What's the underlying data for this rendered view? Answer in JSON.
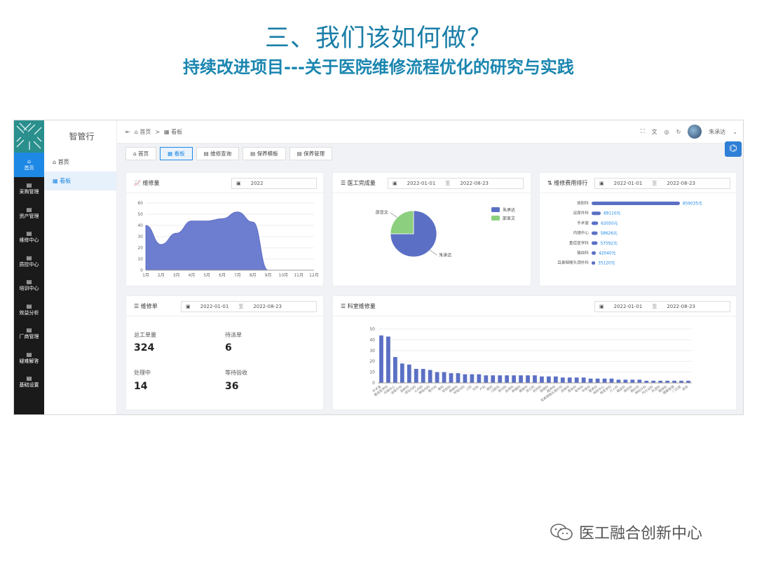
{
  "slide": {
    "title": "三、我们该如何做？",
    "subtitle": "持续改进项目---关于医院维修流程优化的研究与实践"
  },
  "nav": {
    "items": [
      {
        "label": "首页",
        "icon": "home-icon"
      },
      {
        "label": "采购管理",
        "icon": "doc-icon"
      },
      {
        "label": "资产管理",
        "icon": "doc-icon"
      },
      {
        "label": "维修中心",
        "icon": "doc-icon"
      },
      {
        "label": "质控中心",
        "icon": "doc-icon"
      },
      {
        "label": "培训中心",
        "icon": "doc-icon"
      },
      {
        "label": "效益分析",
        "icon": "doc-icon"
      },
      {
        "label": "厂商管理",
        "icon": "doc-icon"
      },
      {
        "label": "疑难解答",
        "icon": "doc-icon"
      },
      {
        "label": "基础设置",
        "icon": "doc-icon"
      }
    ]
  },
  "side": {
    "brand": "智管行",
    "items": [
      {
        "label": "首页"
      },
      {
        "label": "看板"
      }
    ]
  },
  "topbar": {
    "home": "首页",
    "sep": ">",
    "current": "看板",
    "user": "朱承达",
    "menu_glyph": "⇤",
    "fullscreen_glyph": "⛶",
    "badge": "⌬"
  },
  "tabs": [
    {
      "label": "首页"
    },
    {
      "label": "看板"
    },
    {
      "label": "维修查询"
    },
    {
      "label": "保养模板"
    },
    {
      "label": "保养管理"
    }
  ],
  "cards": {
    "repair": {
      "title": "维修量",
      "year": "2022"
    },
    "engineer": {
      "title": "医工完成量",
      "start": "2022-01-01",
      "sep": "至",
      "end": "2022-08-23"
    },
    "cost": {
      "title": "维修费用排行",
      "start": "2022-01-01",
      "sep": "至",
      "end": "2022-08-23"
    },
    "orders": {
      "title": "维修单",
      "start": "2022-01-01",
      "sep": "至",
      "end": "2022-08-23",
      "stats": [
        {
          "label": "总工单量",
          "value": "324"
        },
        {
          "label": "待派单",
          "value": "6"
        },
        {
          "label": "处理中",
          "value": "14"
        },
        {
          "label": "等待验收",
          "value": "36"
        }
      ]
    },
    "dept": {
      "title": "科室维修量",
      "start": "2022-01-01",
      "sep": "至",
      "end": "2022-08-23"
    }
  },
  "watermark": {
    "text": "医工融合创新中心"
  },
  "chart_data": [
    {
      "type": "area",
      "x": [
        "1月",
        "2月",
        "3月",
        "4月",
        "5月",
        "6月",
        "7月",
        "8月",
        "9月",
        "10月",
        "11月",
        "12月"
      ],
      "values": [
        40,
        23,
        33,
        44,
        44,
        46,
        52,
        43,
        0,
        0,
        0,
        0
      ],
      "ylim": [
        0,
        60
      ],
      "yticks": [
        0,
        10,
        20,
        30,
        40,
        50,
        60
      ],
      "color": "#6d7dd0"
    },
    {
      "type": "pie",
      "series": [
        {
          "name": "朱承达",
          "value": 75,
          "color": "#5b70c4"
        },
        {
          "name": "邵显文",
          "value": 25,
          "color": "#8ccf7e"
        }
      ],
      "legend": "top-right"
    },
    {
      "type": "bar",
      "orientation": "horizontal",
      "categories": [
        "放射科",
        "泌尿外科",
        "手术室",
        "内镜中心",
        "重症医学科",
        "输血科",
        "耳鼻咽喉头颈外科"
      ],
      "values": [
        859035,
        89110,
        63050,
        58626,
        57592,
        42040,
        35120
      ],
      "labels": [
        "859035元",
        "89110元",
        "63050元",
        "58626元",
        "57592元",
        "42040元",
        "35120元"
      ]
    },
    {
      "type": "bar",
      "categories": [
        "手术室",
        "重症医学科",
        "内镜中心",
        "泌尿外科",
        "放射科",
        "消化内科",
        "心内科",
        "神经内科",
        "普外科",
        "骨科",
        "检验科",
        "麻醉科",
        "呼吸内科",
        "儿科",
        "妇科",
        "产科",
        "眼科",
        "口腔科",
        "肾内科",
        "血液科",
        "肿瘤科",
        "康复科",
        "急诊科",
        "药剂科",
        "病理科",
        "超声科",
        "耳鼻咽喉头颈外科",
        "皮肤科",
        "感染科",
        "老年科",
        "中医科",
        "营养科",
        "体检中心",
        "核医学科",
        "介入科",
        "输血科",
        "烧伤科",
        "胸外科",
        "神经外科",
        "内分泌科",
        "风湿科",
        "精神科",
        "健康管理",
        "门诊部",
        "其他"
      ],
      "values": [
        44,
        43,
        24,
        18,
        17,
        13,
        13,
        12,
        10,
        10,
        9,
        9,
        8,
        8,
        8,
        7,
        7,
        7,
        7,
        7,
        7,
        7,
        7,
        6,
        6,
        6,
        5,
        5,
        5,
        5,
        4,
        4,
        4,
        4,
        3,
        3,
        3,
        3,
        2,
        2,
        2,
        2,
        2,
        2,
        2
      ],
      "ylim": [
        0,
        50
      ],
      "yticks": [
        0,
        10,
        20,
        30,
        40,
        50
      ],
      "color": "#5b70c4"
    }
  ]
}
